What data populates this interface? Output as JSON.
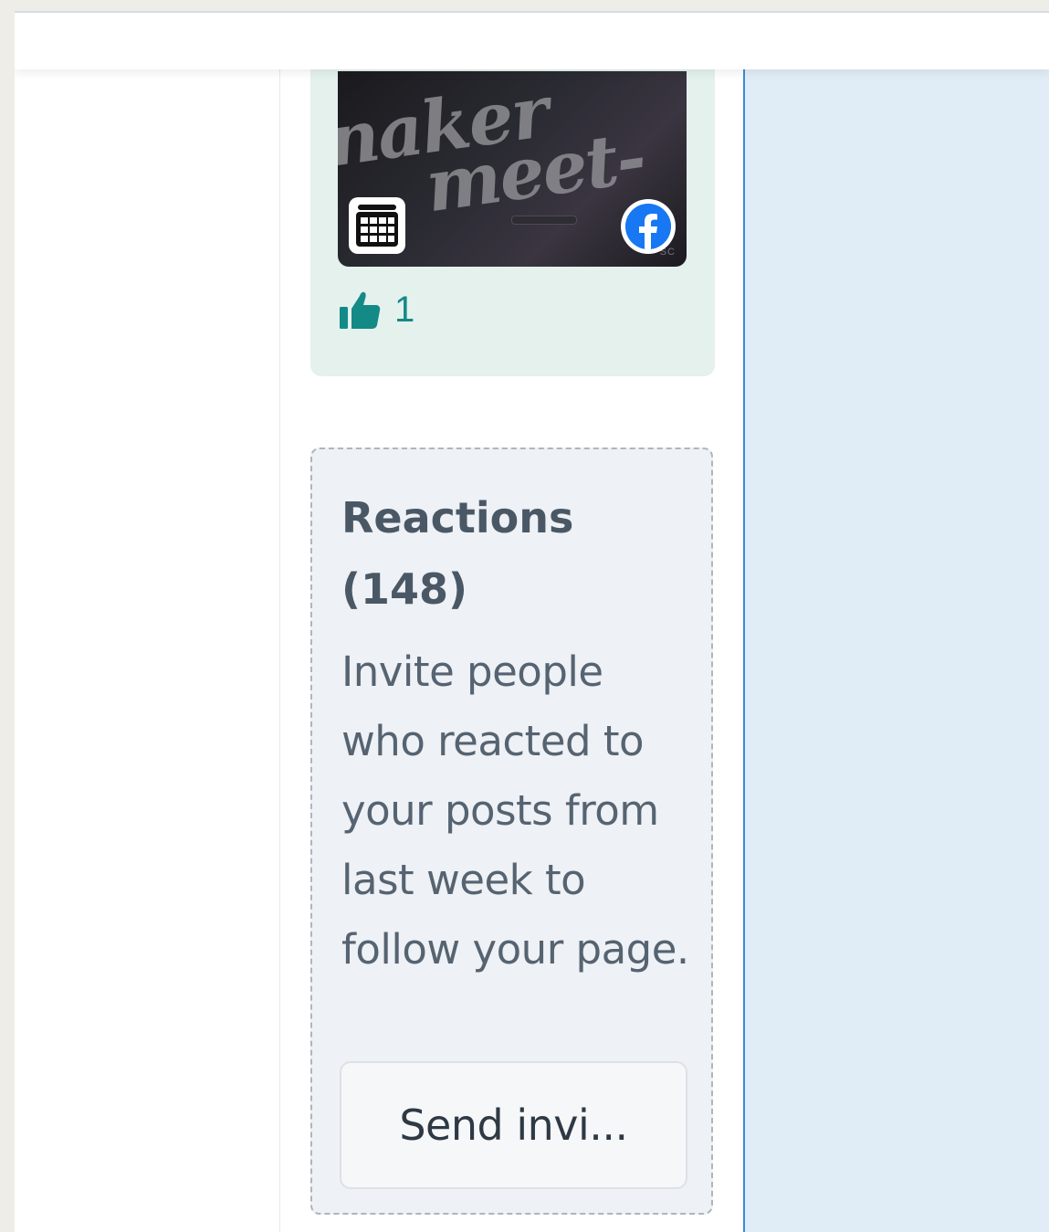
{
  "post": {
    "image": {
      "alt_art_line1": "naker",
      "alt_art_line2": "meet-",
      "tag": "SC"
    },
    "likes_count": "1"
  },
  "reactions": {
    "title": "Reactions (148)",
    "description": "Invite people who reacted to your posts from last week to follow your page.",
    "button_label": "Send invi..."
  },
  "colors": {
    "accent_teal": "#148a87",
    "facebook_blue": "#1877f2",
    "right_pane_bg": "#e0ecf6",
    "right_pane_border": "#3d8bd1",
    "card_bg": "#e4f1ed",
    "reactions_bg": "#eef1f5"
  },
  "icons": [
    "calendar-icon",
    "facebook-icon",
    "thumbs-up-icon"
  ]
}
